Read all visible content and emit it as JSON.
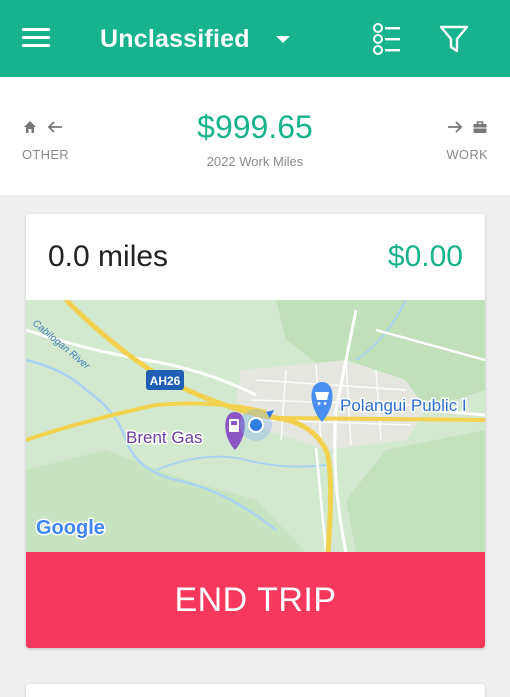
{
  "header": {
    "title": "Unclassified",
    "menu_icon": "hamburger-icon",
    "dropdown_icon": "caret-down-icon",
    "list_icon": "checklist-icon",
    "filter_icon": "filter-icon",
    "color": "#17b38c"
  },
  "summary": {
    "left_label": "OTHER",
    "left_icons": [
      "home-icon",
      "arrow-left-icon"
    ],
    "amount": "$999.65",
    "amount_subtitle": "2022 Work Miles",
    "right_label": "WORK",
    "right_icons": [
      "arrow-right-icon",
      "briefcase-icon"
    ]
  },
  "trip": {
    "miles": "0.0 miles",
    "cost": "$0.00",
    "end_button": "END TRIP",
    "end_button_color": "#f5385c"
  },
  "map": {
    "road_label": "AH26",
    "river_label": "Cabilogan River",
    "place_gas": "Brent Gas",
    "place_store": "Polangui Public I",
    "provider": "Google"
  }
}
